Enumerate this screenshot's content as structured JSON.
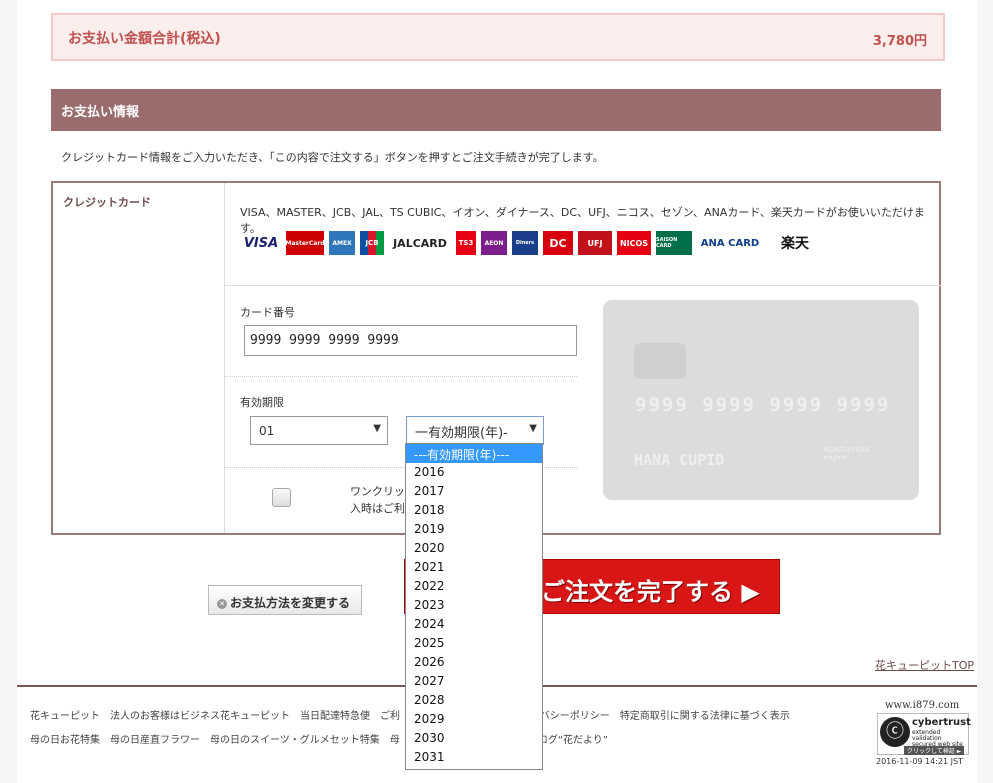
{
  "total": {
    "label": "お支払い金額合計(税込)",
    "value": "3,780円"
  },
  "section": {
    "title": "お支払い情報"
  },
  "intro": "クレジットカード情報をご入力いただき、「この内容で注文する」ボタンを押すとご注文手続きが完了します。",
  "credit": {
    "label": "クレジットカード",
    "brands_text": "VISA、MASTER、JCB、JAL、TS CUBIC、イオン、ダイナース、DC、UFJ、ニコス、セゾン、ANAカード、楽天カードがお使いいただけます。",
    "logos": [
      "VISA",
      "MasterCard",
      "AMEX",
      "JCB",
      "JALCARD",
      "TS3",
      "AEON",
      "Diners",
      "DC",
      "UFJ",
      "NICOS",
      "SAISON CARD",
      "ANA CARD",
      "楽天"
    ],
    "card_number_label": "カード番号",
    "card_number_value": "9999 9999 9999 9999",
    "expiry_label": "有効期限",
    "month_value": "01",
    "year_value": "一有効期限(年)-",
    "oneclick_line1": "ワンクリック",
    "oneclick_line2": "入時はご利"
  },
  "card_preview": {
    "number": "9999 9999 9999 9999",
    "name": "HANA CUPID",
    "expiry": "MONTH/YEAR",
    "expiry_value": "**/**"
  },
  "dropdown_options": [
    "---有効期限(年)---",
    "2016",
    "2017",
    "2018",
    "2019",
    "2020",
    "2021",
    "2022",
    "2023",
    "2024",
    "2025",
    "2026",
    "2027",
    "2028",
    "2029",
    "2030",
    "2031"
  ],
  "buttons": {
    "change_payment": "お支払方法を変更する",
    "complete_order": "ご注文を完了する ▶"
  },
  "top_link": "花キューピットTOP",
  "footer": {
    "row1": "花キューピット　法人のお客様はビジネス花キューピット　当日配達特急便　ご利　　　　　　　　概要　プライバシーポリシー　特定商取引に関する法律に基づく表示",
    "row2": "母の日お花特集　母の日産直フラワー　母の日のスイーツ・グルメセット特集　母　　　　　　　　ook　公式ブログ“花だより”"
  },
  "badge": {
    "domain": "www.i879.com",
    "name": "cybertrust",
    "sub1": "extended validation",
    "sub2": "secured web site",
    "verify": "クリックして検証 ►"
  },
  "timestamp": "2016-11-09 14:21 JST",
  "colors": {
    "section_bg": "#9a6c6b",
    "total_bg": "#fdeeee",
    "accent_red": "#c0504d",
    "order_btn": "#d81616"
  }
}
